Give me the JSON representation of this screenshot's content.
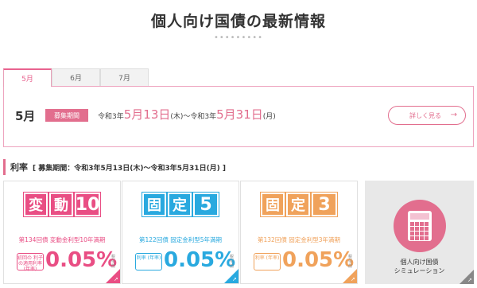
{
  "page": {
    "title": "個人向け国債の最新情報",
    "dots": "•••••••••"
  },
  "tabs": [
    {
      "label": "5月"
    },
    {
      "label": "6月"
    },
    {
      "label": "7月"
    }
  ],
  "info": {
    "month": "5月",
    "badge": "募集期間",
    "start_prefix": "令和3年",
    "start_date": "5月13日",
    "start_day": "(木)～令和3年",
    "end_date": "5月31日",
    "end_day": "(月)",
    "detail_button": "詳しく見る",
    "arrow": "→"
  },
  "rate_section": {
    "title": "利率",
    "period": "[ 募集期間：令和3年5月13日(木)～令和3年5月31日(月) ]"
  },
  "cards": [
    {
      "logo": [
        "変",
        "動",
        "10"
      ],
      "caption": "第134回債 変動金利型10年満期",
      "rate_label": "初回の 利子の適用利率 (年率)",
      "rate": "0.05%",
      "note": "税引前",
      "color": "#e94e84"
    },
    {
      "logo": [
        "固",
        "定",
        "5"
      ],
      "caption": "第122回債 固定金利型5年満期",
      "rate_label": "利率 (年率)",
      "rate": "0.05%",
      "note": "税引前",
      "color": "#29a9df"
    },
    {
      "logo": [
        "固",
        "定",
        "3"
      ],
      "caption": "第132回債 固定金利型3年満期",
      "rate_label": "利率 (年率)",
      "rate": "0.05%",
      "note": "税引前",
      "color": "#f0a25b"
    }
  ],
  "simulation": {
    "line1": "個人向け国債",
    "line2": "シミュレーション"
  },
  "colors": {
    "accent": "#e26e8e",
    "pink": "#e94e84",
    "blue": "#29a9df",
    "orange": "#f0a25b"
  },
  "icons": {
    "calculator": "calculator-icon",
    "arrow": "arrow-right-icon"
  }
}
